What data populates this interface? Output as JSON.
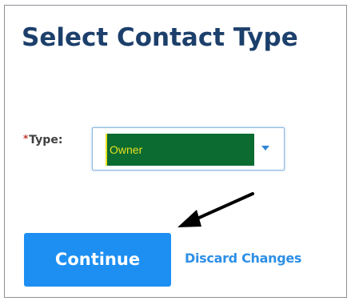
{
  "dialog": {
    "title": "Select Contact Type"
  },
  "form": {
    "type_label": "Type:",
    "required_marker": "*",
    "type_select": {
      "selected": "Owner"
    }
  },
  "actions": {
    "continue_label": "Continue",
    "discard_label": "Discard Changes"
  },
  "annotation": {
    "arrow_icon": "arrow-pointing-icon",
    "arrow_color": "#000000"
  },
  "colors": {
    "title": "#1c3f6b",
    "primary_button": "#1d8ff2",
    "link": "#2d8fe6",
    "select_highlight_bg": "#0b6b31",
    "select_highlight_text": "#e8e020",
    "required": "#c0392b"
  }
}
